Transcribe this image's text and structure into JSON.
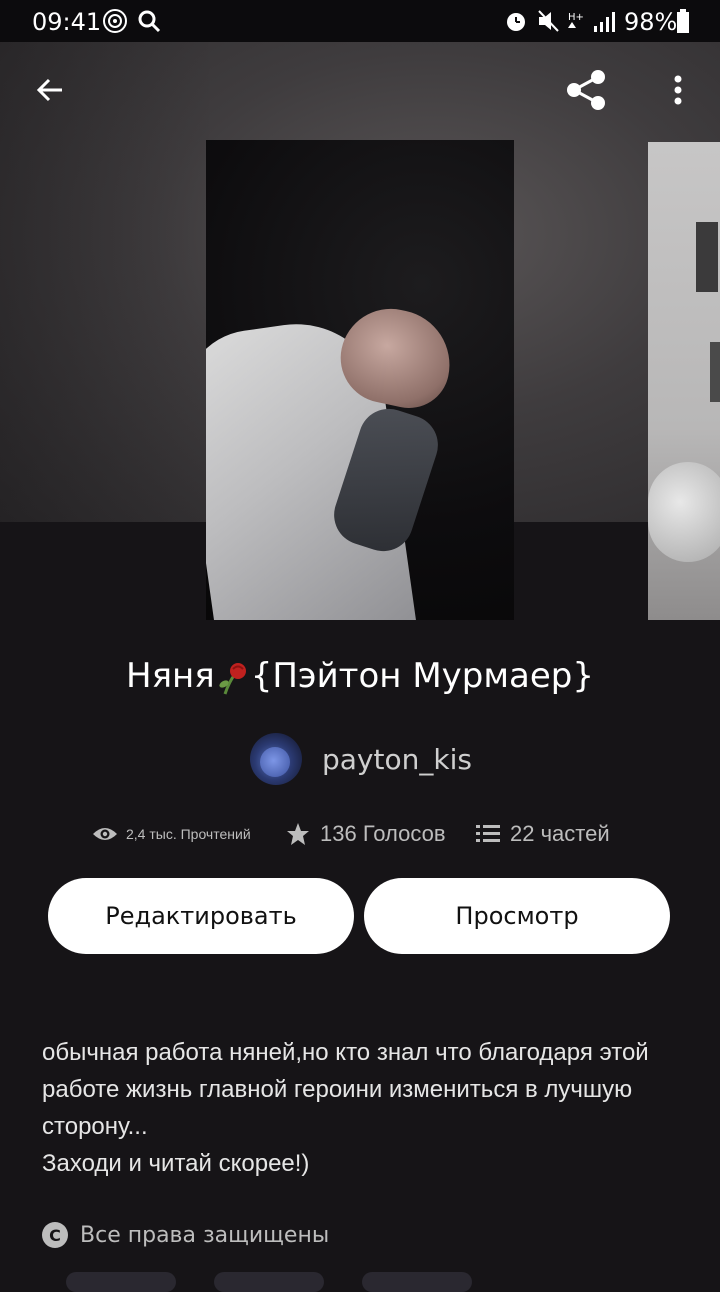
{
  "status_bar": {
    "time": "09:41",
    "battery": "98%"
  },
  "story": {
    "title": "Няня",
    "title_suffix": "{Пэйтон Мурмаер}",
    "author": "payton_kis",
    "stats": {
      "reads": "2,4 тыс. Прочтений",
      "votes": "136 Голосов",
      "parts": "22 частей"
    },
    "buttons": {
      "edit": "Редактировать",
      "preview": "Просмотр"
    },
    "description": [
      "обычная работа няней,но кто знал что благодаря этой работе жизнь главной героини измениться в лучшую сторону...",
      "Заходи и читай скорее!)"
    ],
    "rights": "Все права защищены"
  },
  "icons": {
    "back": "arrow-left-icon",
    "share": "share-icon",
    "menu": "more-vertical-icon",
    "reads": "eye-icon",
    "votes": "star-icon",
    "parts": "list-icon",
    "copyright": "copyright-icon"
  }
}
